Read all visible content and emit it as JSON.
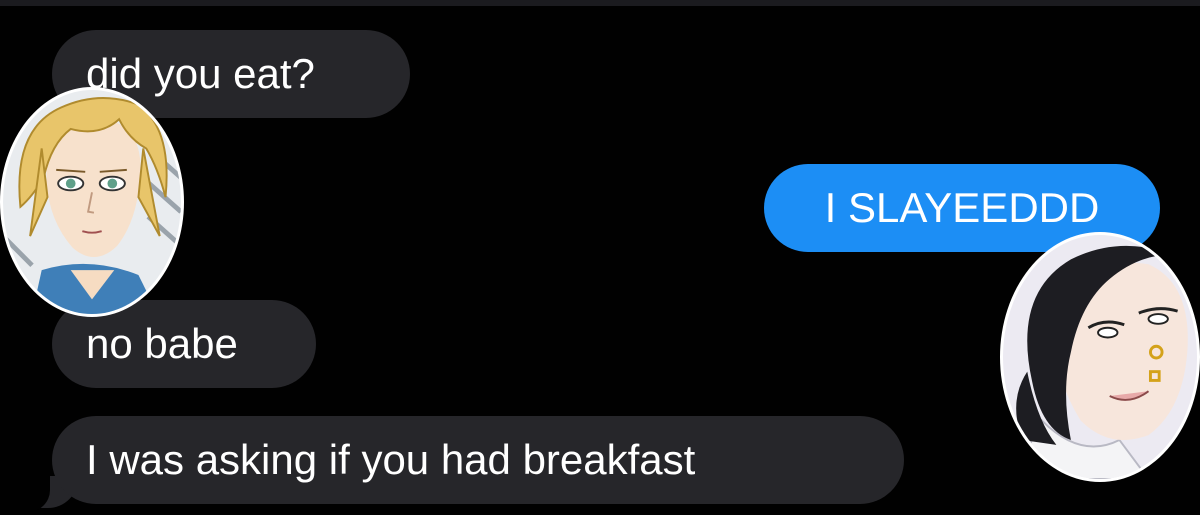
{
  "conversation": {
    "messages": [
      {
        "direction": "incoming",
        "text": "did you eat?"
      },
      {
        "direction": "outgoing",
        "text": "I SLAYEEDDD"
      },
      {
        "direction": "incoming",
        "text": "no babe"
      },
      {
        "direction": "incoming",
        "text": "I was asking if you had breakfast"
      }
    ]
  },
  "avatars": {
    "left": {
      "icon": "blonde-anime-character-avatar-icon"
    },
    "right": {
      "icon": "dark-haired-anime-character-avatar-icon"
    }
  },
  "colors": {
    "background": "#010101",
    "incoming_bubble": "#26262a",
    "outgoing_bubble": "#1c8ef5",
    "text": "#ffffff"
  }
}
